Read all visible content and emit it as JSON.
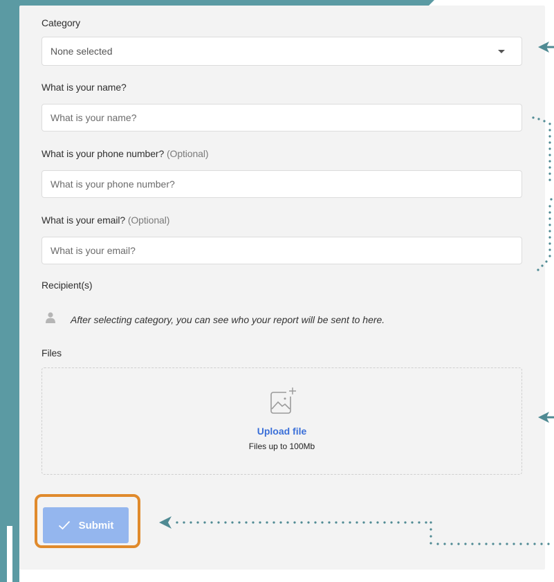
{
  "colors": {
    "teal": "#5b9aa3",
    "card": "#f3f3f3",
    "link": "#3a6fd8",
    "submit": "#94b6ee",
    "highlight": "#e08a2c",
    "annotation": "#4f8a93"
  },
  "form": {
    "category": {
      "label": "Category",
      "selected": "None selected"
    },
    "name": {
      "label": "What is your name?",
      "placeholder": "What is your name?"
    },
    "phone": {
      "label": "What is your phone number?",
      "optional": "(Optional)",
      "placeholder": "What is your phone number?"
    },
    "email": {
      "label": "What is your email?",
      "optional": "(Optional)",
      "placeholder": "What is your email?"
    },
    "recipients": {
      "label": "Recipient(s)",
      "icon": "person-icon",
      "text": "After selecting category, you can see who your report will be sent to here."
    },
    "files": {
      "label": "Files",
      "icon": "image-upload-icon",
      "upload_link": "Upload file",
      "hint": "Files up to 100Mb"
    },
    "submit": {
      "label": "Submit",
      "icon": "checkmark-icon"
    }
  }
}
